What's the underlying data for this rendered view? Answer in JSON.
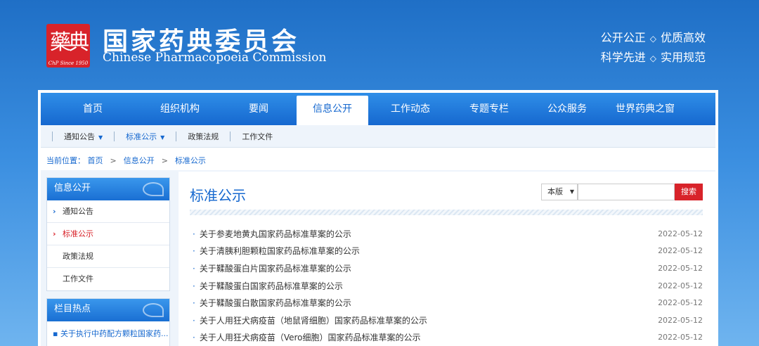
{
  "header": {
    "logo_glyphs": "藥典",
    "logo_since": "ChP Since 1950",
    "title": "国家药典委员会",
    "subtitle": "Chinese Pharmacopoeia Commission",
    "slogan_1a": "公开公正",
    "slogan_1b": "优质高效",
    "slogan_2a": "科学先进",
    "slogan_2b": "实用规范",
    "slogan_sep": "◇"
  },
  "mainnav": {
    "items": [
      "首页",
      "组织机构",
      "要闻",
      "信息公开",
      "工作动态",
      "专题专栏",
      "公众服务",
      "世界药典之窗"
    ],
    "active": "信息公开"
  },
  "subnav": {
    "items": [
      "通知公告",
      "标准公示",
      "政策法规",
      "工作文件"
    ],
    "caret": "▼"
  },
  "breadcrumb": {
    "label": "当前位置：",
    "crumbs": [
      "首页",
      "信息公开",
      "标准公示"
    ],
    "sep": ">"
  },
  "sidebar": {
    "section_title": "信息公开",
    "items": [
      "通知公告",
      "标准公示",
      "政策法规",
      "工作文件"
    ],
    "hot_title": "栏目热点",
    "hot_items": [
      "关于执行中药配方颗粒国家药..."
    ]
  },
  "list": {
    "title": "标准公示",
    "search_scope": "本版",
    "search_button": "搜索",
    "rows": [
      {
        "title": "关于参麦地黄丸国家药品标准草案的公示",
        "date": "2022-05-12"
      },
      {
        "title": "关于清胰利胆颗粒国家药品标准草案的公示",
        "date": "2022-05-12"
      },
      {
        "title": "关于鞣酸蛋白片国家药品标准草案的公示",
        "date": "2022-05-12"
      },
      {
        "title": "关于鞣酸蛋白国家药品标准草案的公示",
        "date": "2022-05-12"
      },
      {
        "title": "关于鞣酸蛋白散国家药品标准草案的公示",
        "date": "2022-05-12"
      },
      {
        "title": "关于人用狂犬病疫苗（地鼠肾细胞）国家药品标准草案的公示",
        "date": "2022-05-12"
      },
      {
        "title": "关于人用狂犬病疫苗（Vero细胞）国家药品标准草案的公示",
        "date": "2022-05-12"
      }
    ]
  },
  "colors": {
    "accent": "#1668cf",
    "highlight": "#d8232a"
  }
}
